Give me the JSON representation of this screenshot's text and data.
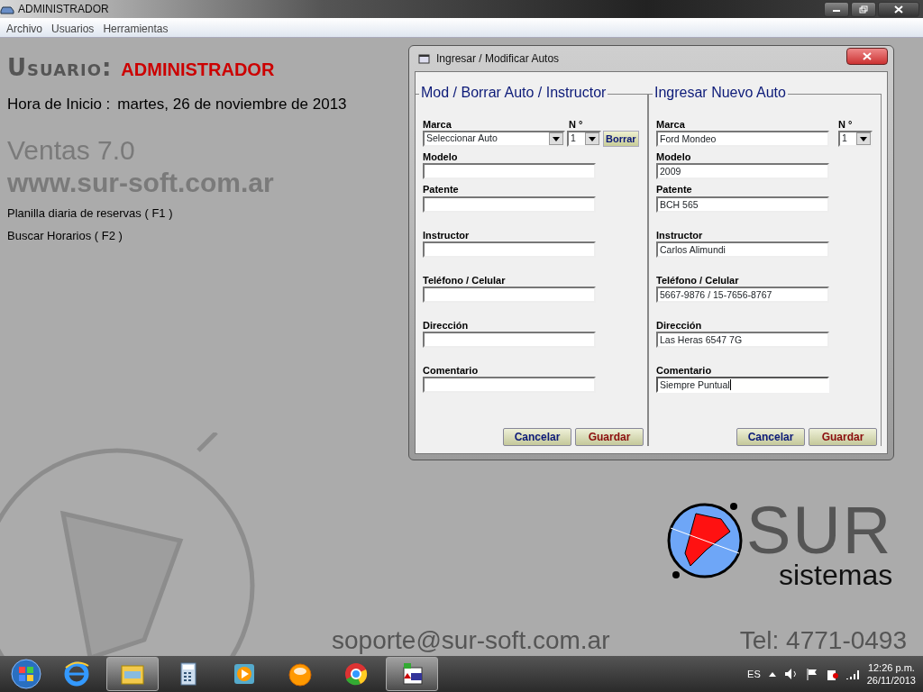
{
  "window": {
    "title": "ADMINISTRADOR"
  },
  "menu": [
    "Archivo",
    "Usuarios",
    "Herramientas"
  ],
  "header": {
    "user_label": "Usuario:",
    "user_name": "ADMINISTRADOR",
    "start_label": "Hora de Inicio :",
    "start_value": "martes, 26 de noviembre de 2013",
    "product": "Ventas 7.0",
    "website": "www.sur-soft.com.ar"
  },
  "shortcuts": [
    "Planilla diaria de reservas ( F1 )",
    "Buscar Horarios ( F2 )"
  ],
  "dialog": {
    "title": "Ingresar /  Modificar  Autos",
    "panels": [
      {
        "title": "Mod / Borrar  Auto / Instructor",
        "marca_label": "Marca",
        "marca": {
          "kind": "select",
          "value": "Seleccionar Auto"
        },
        "number_label": "N °",
        "number_value": "1",
        "action": "Borrar",
        "fields": [
          {
            "label": "Modelo",
            "focused": false
          },
          {
            "label": "Patente",
            "focused": false
          },
          {
            "label": "Instructor",
            "focused": false
          },
          {
            "label": "Teléfono / Celular",
            "focused": false
          },
          {
            "label": "Dirección",
            "focused": false
          },
          {
            "label": "Comentario",
            "focused": false
          }
        ],
        "buttons": [
          "Cancelar",
          "Guardar"
        ]
      },
      {
        "title": "Ingresar Nuevo Auto",
        "marca_label": "Marca",
        "marca": {
          "kind": "text",
          "value": "Ford Mondeo"
        },
        "number_label": "N °",
        "number_value": "1",
        "fields": [
          {
            "label": "Modelo",
            "value": "2009",
            "focused": false
          },
          {
            "label": "Patente",
            "value": "BCH 565",
            "focused": false
          },
          {
            "label": "Instructor",
            "value": "Carlos Alimundi",
            "focused": false
          },
          {
            "label": "Teléfono / Celular",
            "value": "5667-9876 / 15-7656-8767",
            "focused": false
          },
          {
            "label": "Dirección",
            "value": "Las Heras 6547  7G",
            "focused": false
          },
          {
            "label": "Comentario",
            "value": "Siempre Puntual",
            "focused": true
          }
        ],
        "buttons": [
          "Cancelar",
          "Guardar"
        ]
      }
    ]
  },
  "logo": {
    "name": "SUR",
    "subtitle": "sistemas"
  },
  "footer": {
    "email": "soporte@sur-soft.com.ar",
    "phone": "Tel: 4771-0493"
  },
  "taskbar": {
    "items": [
      {
        "kind": "ie",
        "active": false
      },
      {
        "kind": "folder",
        "active": true
      },
      {
        "kind": "calculator",
        "active": false
      },
      {
        "kind": "media",
        "active": false
      },
      {
        "kind": "orb",
        "active": false
      },
      {
        "kind": "chrome",
        "active": false
      },
      {
        "kind": "app",
        "active": true
      }
    ],
    "language": "ES",
    "time": "12:26 p.m.",
    "date": "26/11/2013"
  }
}
